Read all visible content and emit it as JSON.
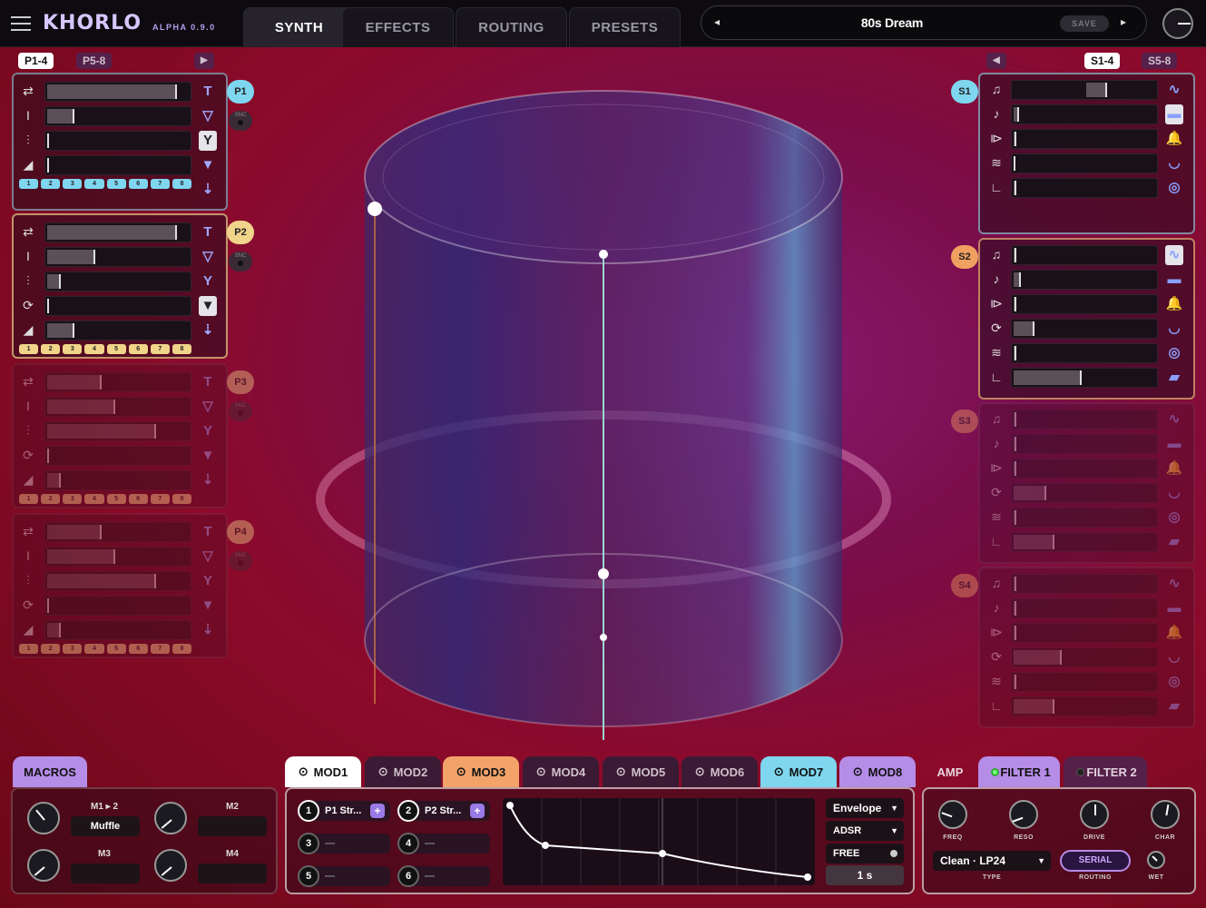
{
  "app": {
    "logo": "KHORLO",
    "version": "ALPHA 0.9.0"
  },
  "nav": {
    "tabs": [
      "SYNTH",
      "EFFECTS",
      "ROUTING",
      "PRESETS"
    ],
    "active": 0
  },
  "preset": {
    "name": "80s Dream",
    "save_label": "SAVE"
  },
  "osc_groups": {
    "left": [
      "P1-4",
      "P5-8"
    ],
    "right": [
      "S1-4",
      "S5-8"
    ]
  },
  "left_panels": [
    {
      "label": "P1",
      "snc": "SNC",
      "accent": "#7fd6ef",
      "fills": [
        0.95,
        0.2,
        0,
        0
      ],
      "steps": [
        "1",
        "2",
        "3",
        "4",
        "5",
        "6",
        "7",
        "8"
      ]
    },
    {
      "label": "P2",
      "snc": "SNC",
      "accent": "#f0d48a",
      "fills": [
        0.95,
        0.35,
        0.1,
        0,
        0.2
      ],
      "steps": [
        "1",
        "2",
        "3",
        "4",
        "5",
        "6",
        "7",
        "8"
      ]
    },
    {
      "label": "P3",
      "snc": "SNC",
      "accent": "#f0d48a",
      "fills": [
        0.4,
        0.5,
        0.8,
        0,
        0.1
      ],
      "steps": [
        "1",
        "2",
        "3",
        "4",
        "5",
        "6",
        "7",
        "8"
      ]
    },
    {
      "label": "P4",
      "snc": "SNC",
      "accent": "#f0d48a",
      "fills": [
        0.4,
        0.5,
        0.8,
        0,
        0.1
      ],
      "steps": [
        "1",
        "2",
        "3",
        "4",
        "5",
        "6",
        "7",
        "8"
      ]
    }
  ],
  "right_panels": [
    {
      "label": "S1",
      "accent": "#7fd6ef"
    },
    {
      "label": "S2",
      "accent": "#f0a060"
    },
    {
      "label": "S3",
      "accent": "#f0a060"
    },
    {
      "label": "S4",
      "accent": "#f0a060"
    }
  ],
  "macros": {
    "tab": "MACROS",
    "items": [
      {
        "label": "M1 ▸ 2",
        "value": "Muffle"
      },
      {
        "label": "M2",
        "value": ""
      },
      {
        "label": "M3",
        "value": ""
      },
      {
        "label": "M4",
        "value": ""
      }
    ]
  },
  "mod_tabs": [
    "MOD1",
    "MOD2",
    "MOD3",
    "MOD4",
    "MOD5",
    "MOD6",
    "MOD7",
    "MOD8"
  ],
  "mod": {
    "slots": [
      {
        "n": "1",
        "text": "P1 Str..."
      },
      {
        "n": "2",
        "text": "P2 Str..."
      },
      {
        "n": "3",
        "text": "—"
      },
      {
        "n": "4",
        "text": "—"
      },
      {
        "n": "5",
        "text": "—"
      },
      {
        "n": "6",
        "text": "—"
      }
    ],
    "type": "Envelope",
    "shape": "ADSR",
    "mode": "FREE",
    "time": "1 s"
  },
  "fx_tabs": [
    "AMP",
    "FILTER 1",
    "FILTER 2"
  ],
  "filter": {
    "knobs": [
      "FREQ",
      "RESO",
      "DRIVE",
      "CHAR"
    ],
    "type_value": "Clean · LP24",
    "type_label": "TYPE",
    "routing_value": "SERIAL",
    "routing_label": "ROUTING",
    "wet_label": "WET"
  }
}
